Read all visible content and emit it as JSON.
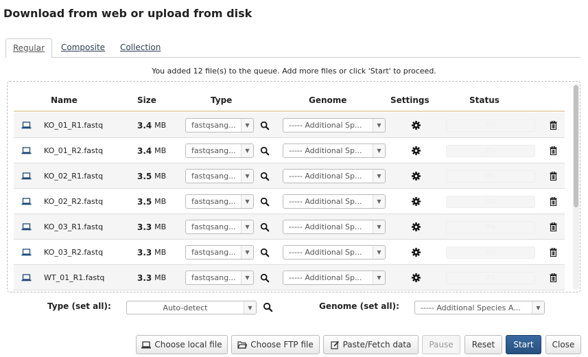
{
  "dialog": {
    "title": "Download from web or upload from disk"
  },
  "tabs": [
    {
      "label": "Regular",
      "active": true
    },
    {
      "label": "Composite",
      "active": false
    },
    {
      "label": "Collection",
      "active": false
    }
  ],
  "queue_message": "You added 12 file(s) to the queue. Add more files or click 'Start' to proceed.",
  "table": {
    "headers": {
      "name": "Name",
      "size": "Size",
      "type": "Type",
      "genome": "Genome",
      "settings": "Settings",
      "status": "Status"
    },
    "rows": [
      {
        "name": "KO_01_R1.fastq",
        "size": "3.4",
        "unit": "MB",
        "type": "fastqsang...",
        "genome": "----- Additional Sp...",
        "status": "0%"
      },
      {
        "name": "KO_01_R2.fastq",
        "size": "3.4",
        "unit": "MB",
        "type": "fastqsang...",
        "genome": "----- Additional Sp...",
        "status": "0%"
      },
      {
        "name": "KO_02_R1.fastq",
        "size": "3.5",
        "unit": "MB",
        "type": "fastqsang...",
        "genome": "----- Additional Sp...",
        "status": "0%"
      },
      {
        "name": "KO_02_R2.fastq",
        "size": "3.5",
        "unit": "MB",
        "type": "fastqsang...",
        "genome": "----- Additional Sp...",
        "status": "0%"
      },
      {
        "name": "KO_03_R1.fastq",
        "size": "3.3",
        "unit": "MB",
        "type": "fastqsang...",
        "genome": "----- Additional Sp...",
        "status": "0%"
      },
      {
        "name": "KO_03_R2.fastq",
        "size": "3.3",
        "unit": "MB",
        "type": "fastqsang...",
        "genome": "----- Additional Sp...",
        "status": "0%"
      },
      {
        "name": "WT_01_R1.fastq",
        "size": "3.3",
        "unit": "MB",
        "type": "fastqsang...",
        "genome": "----- Additional Sp...",
        "status": "0%"
      }
    ]
  },
  "set_all": {
    "type_label": "Type (set all):",
    "type_value": "Auto-detect",
    "genome_label": "Genome (set all):",
    "genome_value": "----- Additional Species A..."
  },
  "buttons": {
    "choose_local": "Choose local file",
    "choose_ftp": "Choose FTP file",
    "paste_fetch": "Paste/Fetch data",
    "pause": "Pause",
    "reset": "Reset",
    "start": "Start",
    "close": "Close"
  },
  "colors": {
    "primary": "#2c5282",
    "header_rule": "#e7d7b3",
    "link": "#2c3e50"
  },
  "icons": {
    "row": "laptop-icon",
    "search": "search-icon",
    "settings": "gear-icon",
    "delete": "trash-icon"
  }
}
